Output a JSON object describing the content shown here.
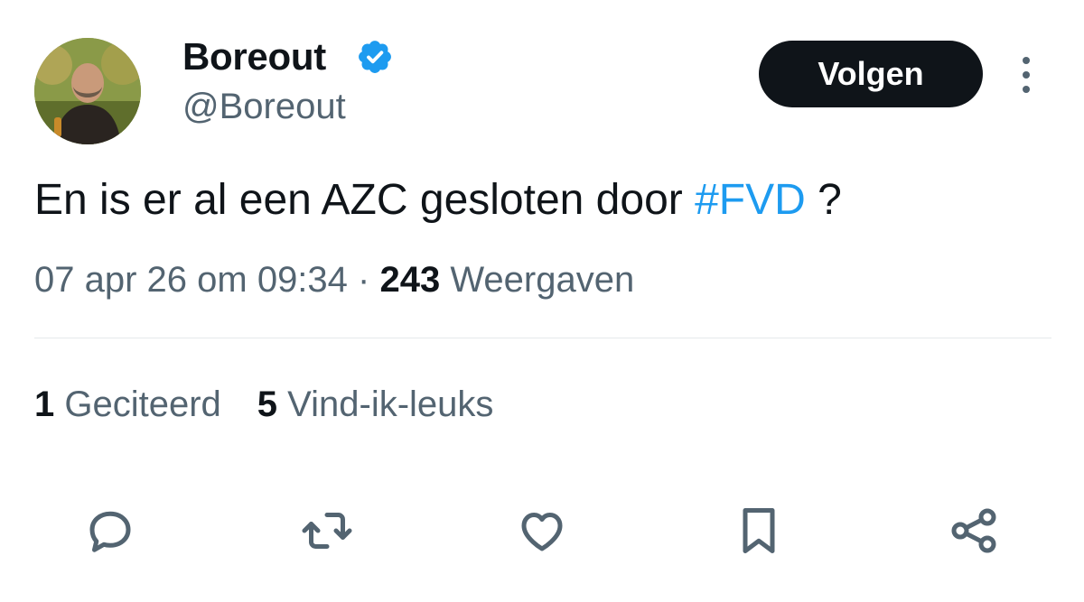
{
  "user": {
    "display_name": "Boreout",
    "handle": "@Boreout",
    "verified": true,
    "avatar_icon": "profile-photo"
  },
  "follow_button": {
    "label": "Volgen"
  },
  "more_icon": "more-vertical-icon",
  "tweet": {
    "text_before": "En is er al een AZC gesloten door ",
    "hashtag": "#FVD",
    "text_after": " ?"
  },
  "meta": {
    "timestamp": "07 apr 26 om 09:34",
    "separator": "·",
    "views_count": "243",
    "views_label": "Weergaven"
  },
  "stats": {
    "quotes_count": "1",
    "quotes_label": "Geciteerd",
    "likes_count": "5",
    "likes_label": "Vind-ik-leuks"
  },
  "actions": [
    "reply-icon",
    "retweet-icon",
    "like-icon",
    "bookmark-icon",
    "share-icon"
  ],
  "colors": {
    "text": "#0f1419",
    "secondary": "#536471",
    "accent": "#1d9bf0",
    "button_bg": "#0f1419",
    "divider": "#e6e9eb"
  }
}
